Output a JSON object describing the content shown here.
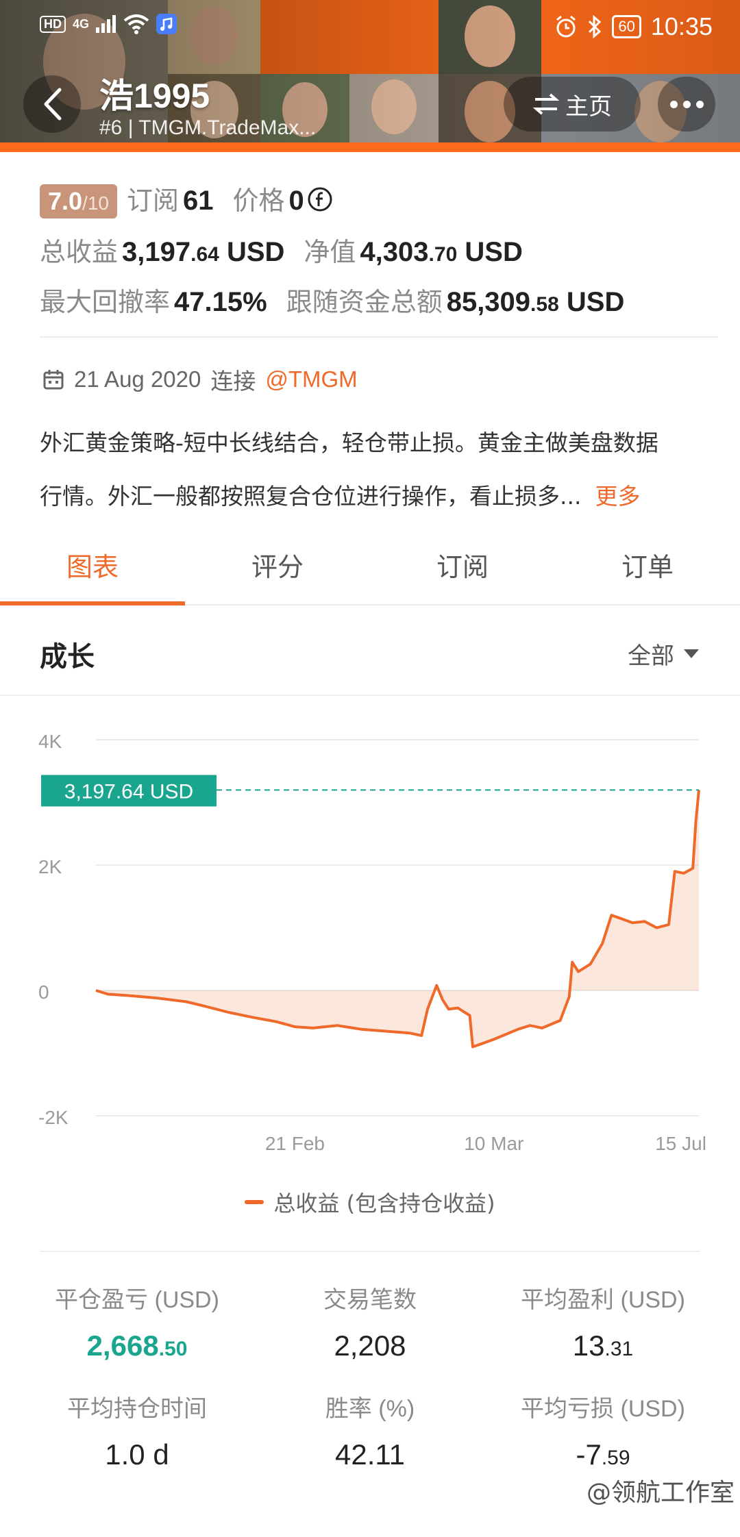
{
  "status_bar": {
    "hd": "HD",
    "network": "4G",
    "battery": "60",
    "time": "10:35"
  },
  "header": {
    "trader_name": "浩1995",
    "subtitle": "#6 | TMGM.TradeMax...",
    "home_label": "主页"
  },
  "profile": {
    "rating": "7.0",
    "rating_max": "/10",
    "subscribe_label": "订阅",
    "subscribe_count": "61",
    "price_label": "价格",
    "price_value": "0",
    "total_profit_label": "总收益",
    "total_profit_int": "3,197",
    "total_profit_dec": ".64",
    "total_profit_unit": "USD",
    "equity_label": "净值",
    "equity_int": "4,303",
    "equity_dec": ".70",
    "equity_unit": "USD",
    "max_drawdown_label": "最大回撤率",
    "max_drawdown_value": "47.15%",
    "follow_funds_label": "跟随资金总额",
    "follow_funds_int": "85,309",
    "follow_funds_dec": ".58",
    "follow_funds_unit": "USD",
    "date": "21 Aug 2020",
    "connect_label": "连接",
    "broker_tag": "@TMGM",
    "description_line1": "外汇黄金策略-短中长线结合，轻仓带止损。黄金主做美盘数据",
    "description_line2": "行情。外汇一般都按照复合仓位进行操作，看止损多...",
    "more_label": "更多"
  },
  "tabs": [
    "图表",
    "评分",
    "订阅",
    "订单"
  ],
  "section": {
    "title": "成长",
    "range": "全部"
  },
  "legend_label": "总收益 (包含持仓收益)",
  "stats": [
    {
      "label": "平仓盈亏 (USD)",
      "int": "2,668",
      "dec": ".50"
    },
    {
      "label": "交易笔数",
      "int": "2,208",
      "dec": ""
    },
    {
      "label": "平均盈利 (USD)",
      "int": "13",
      "dec": ".31"
    },
    {
      "label": "平均持仓时间",
      "int": "1.0 d",
      "dec": ""
    },
    {
      "label": "胜率 (%)",
      "int": "42.11",
      "dec": ""
    },
    {
      "label": "平均亏损 (USD)",
      "int": "-7",
      "dec": ".59"
    }
  ],
  "watermark": "@领航工作室",
  "colors": {
    "accent": "#ef6a2a",
    "green": "#1aa58f",
    "rating_bg": "#c8947a"
  },
  "chart_data": {
    "type": "area",
    "series": [
      {
        "name": "总收益 (包含持仓收益)",
        "points": [
          [
            0.0,
            0
          ],
          [
            0.02,
            -60
          ],
          [
            0.05,
            -80
          ],
          [
            0.1,
            -120
          ],
          [
            0.15,
            -180
          ],
          [
            0.18,
            -250
          ],
          [
            0.22,
            -350
          ],
          [
            0.26,
            -430
          ],
          [
            0.3,
            -500
          ],
          [
            0.33,
            -580
          ],
          [
            0.36,
            -600
          ],
          [
            0.4,
            -560
          ],
          [
            0.44,
            -620
          ],
          [
            0.48,
            -650
          ],
          [
            0.52,
            -680
          ],
          [
            0.54,
            -720
          ],
          [
            0.55,
            -300
          ],
          [
            0.565,
            80
          ],
          [
            0.575,
            -150
          ],
          [
            0.585,
            -300
          ],
          [
            0.6,
            -280
          ],
          [
            0.62,
            -400
          ],
          [
            0.625,
            -900
          ],
          [
            0.64,
            -850
          ],
          [
            0.66,
            -780
          ],
          [
            0.68,
            -700
          ],
          [
            0.7,
            -620
          ],
          [
            0.72,
            -560
          ],
          [
            0.74,
            -600
          ],
          [
            0.77,
            -480
          ],
          [
            0.785,
            -100
          ],
          [
            0.79,
            450
          ],
          [
            0.8,
            300
          ],
          [
            0.82,
            420
          ],
          [
            0.84,
            750
          ],
          [
            0.855,
            1200
          ],
          [
            0.87,
            1150
          ],
          [
            0.89,
            1080
          ],
          [
            0.91,
            1100
          ],
          [
            0.93,
            1000
          ],
          [
            0.95,
            1050
          ],
          [
            0.96,
            1900
          ],
          [
            0.975,
            1870
          ],
          [
            0.99,
            1950
          ],
          [
            0.995,
            2700
          ],
          [
            1.0,
            3197.64
          ]
        ]
      }
    ],
    "x_ticks": [
      "21 Feb",
      "10 Mar",
      "15 Jul"
    ],
    "y_ticks": [
      "4K",
      "2K",
      "0",
      "-2K"
    ],
    "ylim": [
      -2000,
      4000
    ],
    "current_label": "3,197.64 USD",
    "current_value": 3197.64,
    "grid": true
  }
}
